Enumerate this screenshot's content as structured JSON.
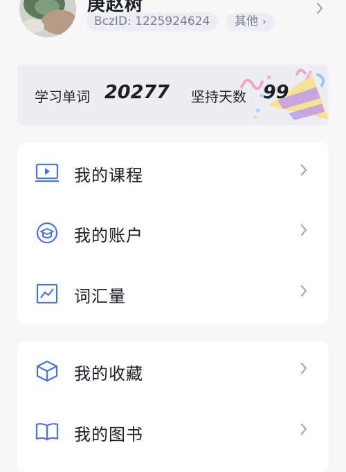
{
  "profile": {
    "username": "庚赵树",
    "bcz_id": "BczID: 1225924624",
    "other_label": "其他",
    "other_icon": "chevron-right-icon"
  },
  "stats": {
    "words_label": "学习单词",
    "words_value": "20277",
    "days_label": "坚持天数",
    "days_value": "99"
  },
  "menu_group_1": [
    {
      "label": "我的课程",
      "icon": "course-icon"
    },
    {
      "label": "我的账户",
      "icon": "account-icon"
    },
    {
      "label": "词汇量",
      "icon": "vocabulary-chart-icon"
    }
  ],
  "menu_group_2": [
    {
      "label": "我的收藏",
      "icon": "favorites-box-icon"
    },
    {
      "label": "我的图书",
      "icon": "book-icon"
    }
  ],
  "colors": {
    "accent": "#4a75d1",
    "background": "#f6f7f9",
    "card": "#ffffff",
    "stats_bg": "#eceef3",
    "text": "#1d1f26",
    "chevron": "#9aa0ad"
  }
}
